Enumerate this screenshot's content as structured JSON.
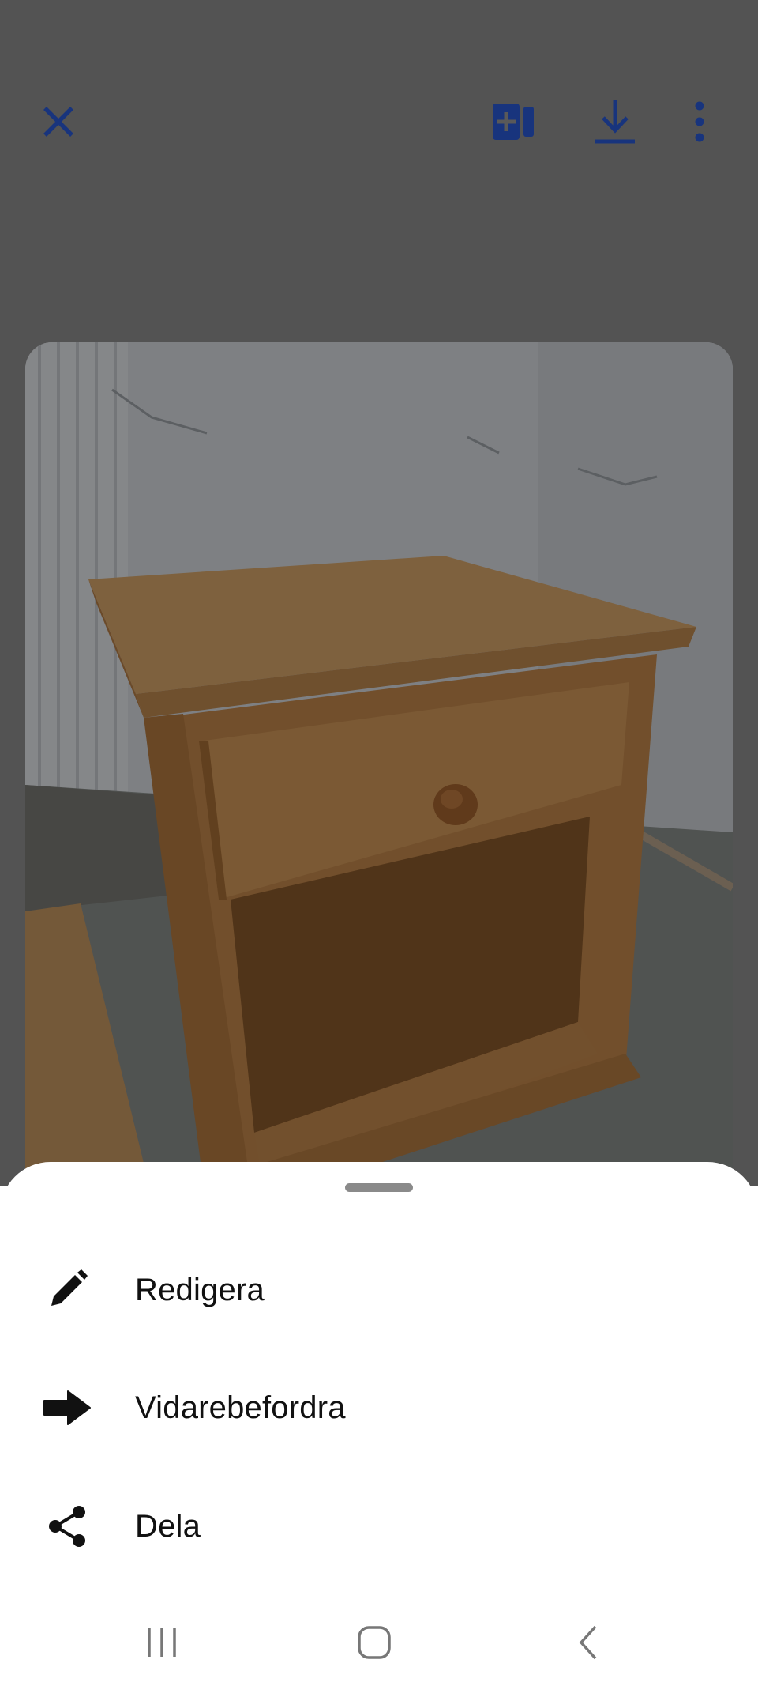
{
  "viewer": {
    "toolbar": {
      "close_icon": "close-icon",
      "add_icon": "add-to-collection-icon",
      "download_icon": "download-icon",
      "more_icon": "more-vertical-icon"
    },
    "accent_color": "#1a3a8f",
    "photo_subject_icon": "photo"
  },
  "sheet": {
    "items": [
      {
        "label": "Redigera",
        "icon": "pencil-icon"
      },
      {
        "label": "Vidarebefordra",
        "icon": "forward-arrow-icon"
      },
      {
        "label": "Dela",
        "icon": "share-icon"
      }
    ]
  },
  "navbar": {
    "recent_icon": "recent-apps-icon",
    "home_icon": "home-icon",
    "back_icon": "back-icon"
  }
}
